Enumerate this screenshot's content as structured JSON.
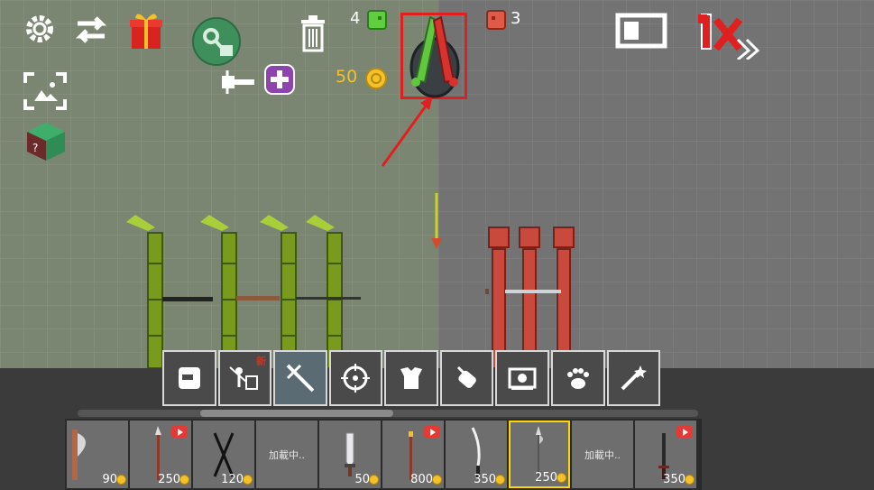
{
  "hud": {
    "green_team_count": "4",
    "red_team_count": "3",
    "coins": "50",
    "speed_label": "1x"
  },
  "categories": [
    {
      "name": "character",
      "icon": "face-block-icon"
    },
    {
      "name": "knight",
      "icon": "knight-shield-icon",
      "badge": "新"
    },
    {
      "name": "melee-weapons",
      "icon": "sword-icon",
      "active": true
    },
    {
      "name": "firearms",
      "icon": "crosshair-icon"
    },
    {
      "name": "armor",
      "icon": "armor-icon"
    },
    {
      "name": "explosives",
      "icon": "bomb-icon"
    },
    {
      "name": "machines",
      "icon": "machine-icon"
    },
    {
      "name": "animals",
      "icon": "paw-icon"
    },
    {
      "name": "magic",
      "icon": "magic-wand-icon"
    }
  ],
  "items": [
    {
      "price": "90",
      "icon": "axe-icon"
    },
    {
      "price": "250",
      "icon": "spear-icon",
      "video": true
    },
    {
      "price": "120",
      "icon": "crossed-swords-icon"
    },
    {
      "loading": "加載中.."
    },
    {
      "price": "50",
      "icon": "broadsword-icon"
    },
    {
      "price": "800",
      "icon": "staff-icon",
      "video": true
    },
    {
      "price": "350",
      "icon": "katana-icon"
    },
    {
      "price": "250",
      "icon": "halberd-icon",
      "selected": true
    },
    {
      "loading": "加載中.."
    },
    {
      "price": "350",
      "icon": "dark-sword-icon",
      "video": true
    }
  ],
  "colors": {
    "green_team": "#8fb52b",
    "red_team": "#c94a3c",
    "highlight": "#e02020",
    "coin": "#f3c22a"
  }
}
